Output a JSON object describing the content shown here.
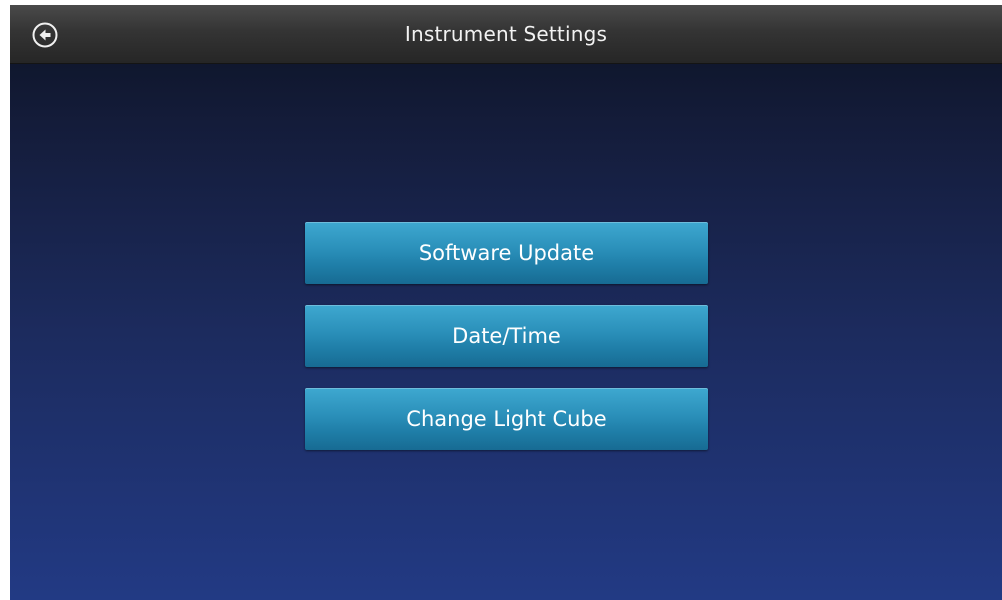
{
  "header": {
    "title": "Instrument Settings",
    "back_icon": "back-arrow-circle-icon"
  },
  "menu": {
    "items": [
      {
        "label": "Software Update"
      },
      {
        "label": "Date/Time"
      },
      {
        "label": "Change Light Cube"
      }
    ]
  },
  "colors": {
    "title_bar": "#343434",
    "background_top": "#0b1222",
    "background_bottom": "#223a84",
    "button": "#2a8fb9",
    "text": "#ffffff"
  }
}
